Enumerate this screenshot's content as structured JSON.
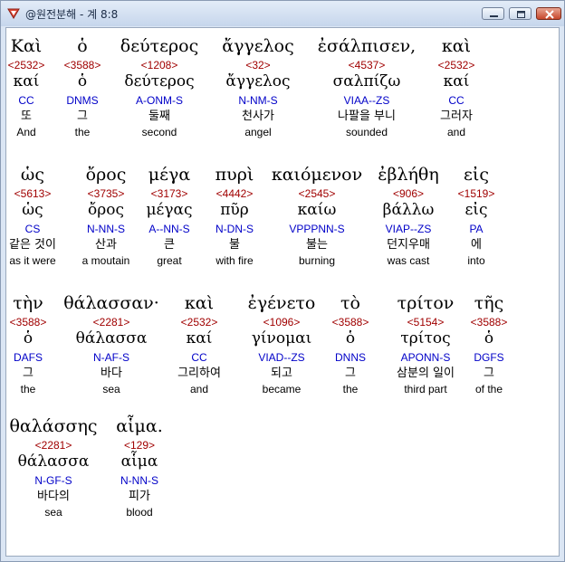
{
  "window": {
    "title": "@원전분해 - 계 8:8"
  },
  "rows": [
    {
      "words": [
        {
          "greek": "Καὶ",
          "strong": "<2532>",
          "lemma": "καί",
          "parse": "CC",
          "korean": "또",
          "english": "And",
          "highlight": true
        },
        {
          "greek": "ὁ",
          "strong": "<3588>",
          "lemma": "ὁ",
          "parse": "DNMS",
          "korean": "그",
          "english": "the"
        },
        {
          "greek": "δεύτερος",
          "strong": "<1208>",
          "lemma": "δεύτερος",
          "parse": "A-ONM-S",
          "korean": "둘째",
          "english": "second"
        },
        {
          "greek": "ἄγγελος",
          "strong": "<32>",
          "lemma": "ἄγγελος",
          "parse": "N-NM-S",
          "korean": "천사가",
          "english": "angel"
        },
        {
          "greek": "ἐσάλπισεν,",
          "strong": "<4537>",
          "lemma": "σαλπίζω",
          "parse": "VIAA--ZS",
          "korean": "나팔을 부니",
          "english": "sounded"
        },
        {
          "greek": "καὶ",
          "strong": "<2532>",
          "lemma": "καί",
          "parse": "CC",
          "korean": "그러자",
          "english": "and"
        }
      ]
    },
    {
      "words": [
        {
          "greek": "ὡς",
          "strong": "<5613>",
          "lemma": "ὡς",
          "parse": "CS",
          "korean": "같은 것이",
          "english": "as it were"
        },
        {
          "greek": "ὄρος",
          "strong": "<3735>",
          "lemma": "ὄρος",
          "parse": "N-NN-S",
          "korean": "산과",
          "english": "a moutain"
        },
        {
          "greek": "μέγα",
          "strong": "<3173>",
          "lemma": "μέγας",
          "parse": "A--NN-S",
          "korean": "큰",
          "english": "great"
        },
        {
          "greek": "πυρὶ",
          "strong": "<4442>",
          "lemma": "πῦρ",
          "parse": "N-DN-S",
          "korean": "불",
          "english": "with fire"
        },
        {
          "greek": "καιόμενον",
          "strong": "<2545>",
          "lemma": "καίω",
          "parse": "VPPPNN-S",
          "korean": "불는",
          "english": "burning"
        },
        {
          "greek": "ἐβλήθη",
          "strong": "<906>",
          "lemma": "βάλλω",
          "parse": "VIAP--ZS",
          "korean": "던지우매",
          "english": "was cast"
        },
        {
          "greek": "εἰς",
          "strong": "<1519>",
          "lemma": "εἰς",
          "parse": "PA",
          "korean": "에",
          "english": "into"
        }
      ]
    },
    {
      "words": [
        {
          "greek": "τὴν",
          "strong": "<3588>",
          "lemma": "ὁ",
          "parse": "DAFS",
          "korean": "그",
          "english": "the"
        },
        {
          "greek": "θάλασσαν·",
          "strong": "<2281>",
          "lemma": "θάλασσα",
          "parse": "N-AF-S",
          "korean": "바다",
          "english": "sea"
        },
        {
          "greek": "καὶ",
          "strong": "<2532>",
          "lemma": "καί",
          "parse": "CC",
          "korean": "그리하여",
          "english": "and"
        },
        {
          "greek": "ἐγένετο",
          "strong": "<1096>",
          "lemma": "γίνομαι",
          "parse": "VIAD--ZS",
          "korean": "되고",
          "english": "became"
        },
        {
          "greek": "τὸ",
          "strong": "<3588>",
          "lemma": "ὁ",
          "parse": "DNNS",
          "korean": "그",
          "english": "the"
        },
        {
          "greek": "τρίτον",
          "strong": "<5154>",
          "lemma": "τρίτος",
          "parse": "APONN-S",
          "korean": "삼분의 일이",
          "english": "third part"
        },
        {
          "greek": "τῆς",
          "strong": "<3588>",
          "lemma": "ὁ",
          "parse": "DGFS",
          "korean": "그",
          "english": "of the"
        }
      ]
    },
    {
      "words": [
        {
          "greek": "θαλάσσης",
          "strong": "<2281>",
          "lemma": "θάλασσα",
          "parse": "N-GF-S",
          "korean": "바다의",
          "english": "sea"
        },
        {
          "greek": "αἷμα.",
          "strong": "<129>",
          "lemma": "αἷμα",
          "parse": "N-NN-S",
          "korean": "피가",
          "english": "blood"
        }
      ]
    }
  ]
}
